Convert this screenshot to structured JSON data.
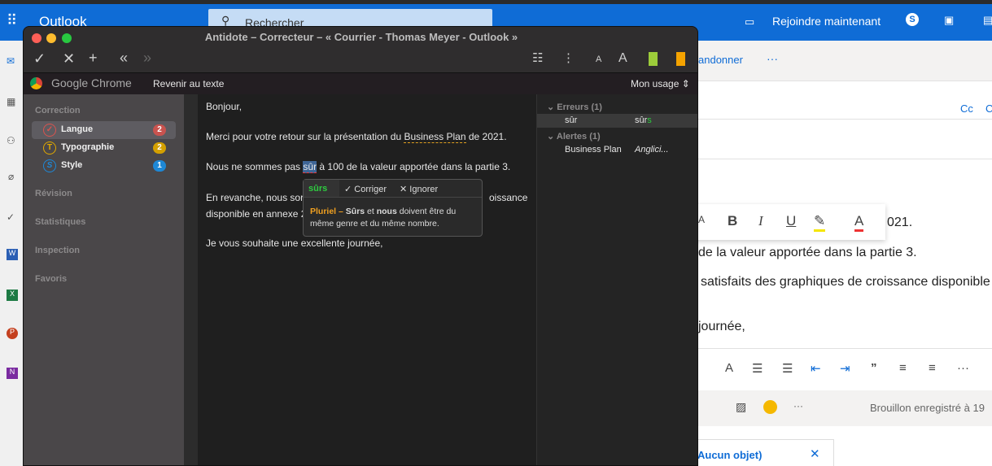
{
  "outlook": {
    "app_name": "Outlook",
    "search_placeholder": "Rechercher",
    "join_label": "Rejoindre maintenant",
    "discard_label": "andonner",
    "more": "···",
    "cc": "Cc",
    "cci": "C",
    "body_lines": [
      "021.",
      "de la valeur apportée dans la partie 3.",
      "satisfaits des graphiques de croissance disponible",
      "journée,"
    ],
    "draft_status": "Brouillon enregistré à 19",
    "tab_label": "Aucun objet)",
    "format": {
      "bold": "B",
      "italic": "I",
      "underline": "U",
      "font_color": "A",
      "grow": "A"
    },
    "quote": "”"
  },
  "antidote": {
    "title": "Antidote – Correcteur – « Courrier - Thomas Meyer - Outlook »",
    "source_app": "Google Chrome",
    "back_label": "Revenir au texte",
    "usage_label": "Mon usage",
    "sidebar": {
      "section": "Correction",
      "items": [
        {
          "label": "Langue",
          "count": "2",
          "color": "#d9534f"
        },
        {
          "label": "Typographie",
          "count": "2",
          "color": "#e0a800"
        },
        {
          "label": "Style",
          "count": "1",
          "color": "#1e88d6"
        }
      ],
      "sections": [
        "Révision",
        "Statistiques",
        "Inspection",
        "Favoris"
      ]
    },
    "text": {
      "l1": "Bonjour,",
      "l2a": "Merci pour votre retour sur la présentation du ",
      "l2b": "Business Plan",
      "l2c": " de 2021.",
      "l3a": "Nous ne sommes pas ",
      "l3b": "sûr",
      "l3c": " à 100 de la valeur apportée dans la partie 3.",
      "l4a": "En revanche, nous sor",
      "l4b": "oissance",
      "l5": "disponible en annexe 2",
      "l6": "Je vous souhaite une excellente journée,"
    },
    "popup": {
      "suggestion": "sûrs",
      "fix": "Corriger",
      "ignore": "Ignorer",
      "type": "Pluriel –",
      "b1": "Sûrs",
      "m1": " et ",
      "b2": "nous",
      "m2": " doivent être du",
      "l2": "même genre et du même nombre."
    },
    "panel": {
      "errors": "Erreurs (1)",
      "err_word": "sûr",
      "err_fix": "sûr",
      "err_fix_add": "s",
      "alerts": "Alertes (1)",
      "alert_word": "Business Plan",
      "alert_type": "Anglici..."
    }
  }
}
